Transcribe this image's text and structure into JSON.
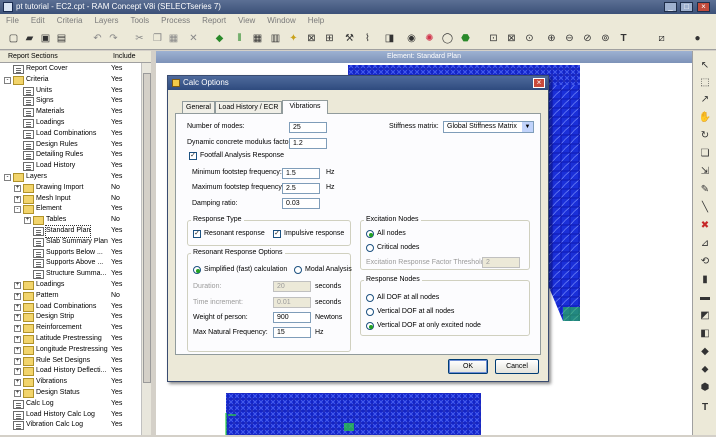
{
  "window": {
    "title": "pt tutorial - EC2.cpt - RAM Concept V8i (SELECTseries 7)",
    "buttons": {
      "minimize": "_",
      "maximize": "□",
      "close": "×"
    }
  },
  "menu": [
    "File",
    "Edit",
    "Criteria",
    "Layers",
    "Tools",
    "Process",
    "Report",
    "View",
    "Window",
    "Help"
  ],
  "toolbar_icons": [
    "new-doc-icon",
    "open-folder-icon",
    "save-icon",
    "print-icon",
    "undo-icon",
    "redo-icon",
    "cut-icon",
    "copy-icon",
    "paste-icon",
    "delete-icon",
    "move-icon",
    "plan-view-icon",
    "grid-icon",
    "layers-icon",
    "tendon-icon",
    "bar-icon",
    "support-icon",
    "color-wheel-icon",
    "display-icon",
    "zoom-in-icon",
    "zoom-out-icon",
    "zoom-window-icon",
    "text-icon"
  ],
  "report_panel": {
    "col_sections": "Report Sections",
    "col_include": "Include",
    "rows": [
      {
        "label": "Report Cover",
        "include": "Yes",
        "depth": 1,
        "type": "doc"
      },
      {
        "label": "Criteria",
        "include": "Yes",
        "depth": 1,
        "type": "folder",
        "toggle": "-"
      },
      {
        "label": "Units",
        "include": "Yes",
        "depth": 2,
        "type": "doc"
      },
      {
        "label": "Signs",
        "include": "Yes",
        "depth": 2,
        "type": "doc"
      },
      {
        "label": "Materials",
        "include": "Yes",
        "depth": 2,
        "type": "doc"
      },
      {
        "label": "Loadings",
        "include": "Yes",
        "depth": 2,
        "type": "doc"
      },
      {
        "label": "Load Combinations",
        "include": "Yes",
        "depth": 2,
        "type": "doc"
      },
      {
        "label": "Design Rules",
        "include": "Yes",
        "depth": 2,
        "type": "doc"
      },
      {
        "label": "Detailing Rules",
        "include": "Yes",
        "depth": 2,
        "type": "doc"
      },
      {
        "label": "Load History",
        "include": "Yes",
        "depth": 2,
        "type": "doc"
      },
      {
        "label": "Layers",
        "include": "Yes",
        "depth": 1,
        "type": "folder",
        "toggle": "-"
      },
      {
        "label": "Drawing Import",
        "include": "No",
        "depth": 2,
        "type": "folder",
        "toggle": "+"
      },
      {
        "label": "Mesh Input",
        "include": "No",
        "depth": 2,
        "type": "folder",
        "toggle": "+"
      },
      {
        "label": "Element",
        "include": "Yes",
        "depth": 2,
        "type": "folder",
        "toggle": "-"
      },
      {
        "label": "Tables",
        "include": "No",
        "depth": 3,
        "type": "folder",
        "toggle": "+"
      },
      {
        "label": "Standard Plan",
        "include": "Yes",
        "depth": 3,
        "type": "doc",
        "selected": true
      },
      {
        "label": "Slab Summary Plan",
        "include": "Yes",
        "depth": 3,
        "type": "doc"
      },
      {
        "label": "Supports Below ...",
        "include": "Yes",
        "depth": 3,
        "type": "doc"
      },
      {
        "label": "Supports Above ...",
        "include": "Yes",
        "depth": 3,
        "type": "doc"
      },
      {
        "label": "Structure Summa...",
        "include": "Yes",
        "depth": 3,
        "type": "doc"
      },
      {
        "label": "Loadings",
        "include": "Yes",
        "depth": 2,
        "type": "folder",
        "toggle": "+"
      },
      {
        "label": "Pattern",
        "include": "No",
        "depth": 2,
        "type": "folder",
        "toggle": "+"
      },
      {
        "label": "Load Combinations",
        "include": "Yes",
        "depth": 2,
        "type": "folder",
        "toggle": "+"
      },
      {
        "label": "Design Strip",
        "include": "Yes",
        "depth": 2,
        "type": "folder",
        "toggle": "+"
      },
      {
        "label": "Reinforcement",
        "include": "Yes",
        "depth": 2,
        "type": "folder",
        "toggle": "+"
      },
      {
        "label": "Latitude Prestressing",
        "include": "Yes",
        "depth": 2,
        "type": "folder",
        "toggle": "+"
      },
      {
        "label": "Longitude Prestressing",
        "include": "Yes",
        "depth": 2,
        "type": "folder",
        "toggle": "+"
      },
      {
        "label": "Rule Set Designs",
        "include": "Yes",
        "depth": 2,
        "type": "folder",
        "toggle": "+"
      },
      {
        "label": "Load History Deflecti...",
        "include": "Yes",
        "depth": 2,
        "type": "folder",
        "toggle": "+"
      },
      {
        "label": "Vibrations",
        "include": "Yes",
        "depth": 2,
        "type": "folder",
        "toggle": "+"
      },
      {
        "label": "Design Status",
        "include": "Yes",
        "depth": 2,
        "type": "folder",
        "toggle": "+"
      },
      {
        "label": "Calc Log",
        "include": "Yes",
        "depth": 1,
        "type": "doc"
      },
      {
        "label": "Load History Calc Log",
        "include": "Yes",
        "depth": 1,
        "type": "doc"
      },
      {
        "label": "Vibration Calc Log",
        "include": "Yes",
        "depth": 1,
        "type": "doc"
      }
    ]
  },
  "drawing_window": {
    "title": "Element: Standard Plan"
  },
  "right_tool_icons": [
    "pointer-icon",
    "select-box-icon",
    "arrow-icon",
    "hand-icon",
    "rotate-icon",
    "copy-tool-icon",
    "move-tool-icon",
    "edit-tool-icon",
    "line-tool-icon",
    "cross-tool-icon",
    "measure-icon",
    "orbit-icon",
    "column-icon",
    "wall-icon",
    "slab-icon",
    "beam-icon",
    "point-load-icon",
    "line-load-icon",
    "area-load-icon",
    "text-tool-icon"
  ],
  "dialog": {
    "title": "Calc Options",
    "tabs": [
      "General",
      "Load History / ECR",
      "Vibrations"
    ],
    "active_tab": "Vibrations",
    "number_of_modes": {
      "label": "Number of modes:",
      "value": "25"
    },
    "stiffness_matrix": {
      "label": "Stiffness matrix:",
      "value": "Global Stiffness Matrix"
    },
    "concrete_modulus": {
      "label": "Dynamic concrete modulus factor:",
      "value": "1.2"
    },
    "footfall": {
      "label": "Footfall Analysis Response",
      "checked": true
    },
    "min_freq": {
      "label": "Minimum footstep frequency:",
      "value": "1.5",
      "unit": "Hz"
    },
    "max_freq": {
      "label": "Maximum footstep frequency:",
      "value": "2.5",
      "unit": "Hz"
    },
    "damping": {
      "label": "Damping ratio:",
      "value": "0.03"
    },
    "response_type": {
      "title": "Response Type",
      "resonant": {
        "label": "Resonant response",
        "checked": true
      },
      "impulsive": {
        "label": "Impulsive response",
        "checked": true
      }
    },
    "resonant_options": {
      "title": "Resonant Response Options",
      "simplified": {
        "label": "Simplified (fast) calculation",
        "selected": true
      },
      "modal": {
        "label": "Modal Analysis",
        "selected": false
      },
      "duration": {
        "label": "Duration:",
        "value": "20",
        "unit": "seconds"
      },
      "time_increment": {
        "label": "Time increment:",
        "value": "0.01",
        "unit": "seconds"
      },
      "weight": {
        "label": "Weight of person:",
        "value": "900",
        "unit": "Newtons"
      },
      "max_nat_freq": {
        "label": "Max Natural Frequency:",
        "value": "15",
        "unit": "Hz"
      }
    },
    "excitation_nodes": {
      "title": "Excitation Nodes",
      "all": {
        "label": "All nodes",
        "selected": true
      },
      "critical": {
        "label": "Critical nodes",
        "selected": false
      },
      "threshold": {
        "label": "Excitation Response Factor Threshold:",
        "value": "2"
      }
    },
    "response_nodes": {
      "title": "Response Nodes",
      "all_dof": {
        "label": "All DOF at all nodes",
        "selected": false
      },
      "vertical_all": {
        "label": "Vertical DOF at all nodes",
        "selected": false
      },
      "vertical_excited": {
        "label": "Vertical DOF at only excited node",
        "selected": true
      }
    },
    "ok_label": "OK",
    "cancel_label": "Cancel",
    "close_glyph": "×"
  },
  "colors": {
    "mesh_blue": "#1a2fd8",
    "mesh_dark": "#00008a",
    "mesh_green": "#2bd13a",
    "title_blue": "#3c5178"
  }
}
